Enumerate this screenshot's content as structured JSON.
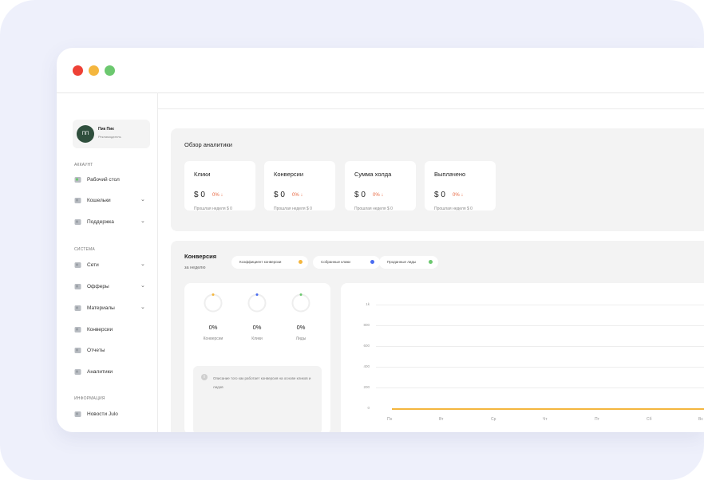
{
  "user": {
    "initials": "ПП",
    "name": "Пик Пик",
    "role": "Рекламодатель"
  },
  "sidebar": {
    "sections": [
      {
        "title": "АККАУНТ"
      },
      {
        "title": "СИСТЕМА"
      },
      {
        "title": "ИНФОРМАЦИЯ"
      }
    ],
    "items": [
      {
        "label": "Рабочий стол",
        "icon": "dashboard-icon",
        "has_chevron": false
      },
      {
        "label": "Кошельки",
        "icon": "wallet-icon",
        "has_chevron": true
      },
      {
        "label": "Поддержка",
        "icon": "support-icon",
        "has_chevron": true
      },
      {
        "label": "Сети",
        "icon": "network-icon",
        "has_chevron": true
      },
      {
        "label": "Офферы",
        "icon": "offers-icon",
        "has_chevron": true
      },
      {
        "label": "Материалы",
        "icon": "materials-icon",
        "has_chevron": true
      },
      {
        "label": "Конверсии",
        "icon": "conversions-icon",
        "has_chevron": false
      },
      {
        "label": "Отчеты",
        "icon": "reports-icon",
        "has_chevron": false
      },
      {
        "label": "Аналитики",
        "icon": "analytics-icon",
        "has_chevron": false
      },
      {
        "label": "Новости Julo",
        "icon": "news-icon",
        "has_chevron": false
      }
    ],
    "chevron": "⌄"
  },
  "overview": {
    "title": "Обзор аналитики",
    "cards": [
      {
        "title": "Клики",
        "value": "$ 0",
        "pct": "0% ↓",
        "sub": "Прошлая неделя $ 0"
      },
      {
        "title": "Конверсии",
        "value": "$ 0",
        "pct": "0% ↓",
        "sub": "Прошлая неделя $ 0"
      },
      {
        "title": "Сумма холда",
        "value": "$ 0",
        "pct": "0% ↓",
        "sub": "Прошлая неделя $ 0"
      },
      {
        "title": "Выплачено",
        "value": "$ 0",
        "pct": "0% ↓",
        "sub": "Прошлая неделя $ 0"
      }
    ]
  },
  "conversion": {
    "title": "Конверсия",
    "subtitle": "за неделю",
    "legend": [
      {
        "label": "Коэффициент конверсии",
        "color": "#f4b63e"
      },
      {
        "label": "Собранные клики",
        "color": "#4a6cf0"
      },
      {
        "label": "Проданные лиды",
        "color": "#6cc86f"
      }
    ],
    "rings": [
      {
        "value": "0%",
        "label": "Конверсии",
        "color": "#f4b63e",
        "progress": 0
      },
      {
        "value": "0%",
        "label": "Клики",
        "color": "#4a6cf0",
        "progress": 0
      },
      {
        "value": "0%",
        "label": "Лиды",
        "color": "#6cc86f",
        "progress": 0
      }
    ],
    "info_text": "Описание того как работает конверсия на основе кликов и лидов",
    "info_icon": "info-icon"
  },
  "chart_data": {
    "type": "line",
    "categories": [
      "Пн",
      "Вт",
      "Ср",
      "Чт",
      "Пт",
      "Сб",
      "Вс"
    ],
    "y_ticks": [
      "1k",
      "800",
      "600",
      "400",
      "200",
      "0"
    ],
    "series": [
      {
        "values": [
          0,
          0,
          0,
          0,
          0,
          0,
          0
        ],
        "color": "#f4b63e"
      }
    ],
    "ylim": [
      0,
      1000
    ],
    "grid": true
  }
}
